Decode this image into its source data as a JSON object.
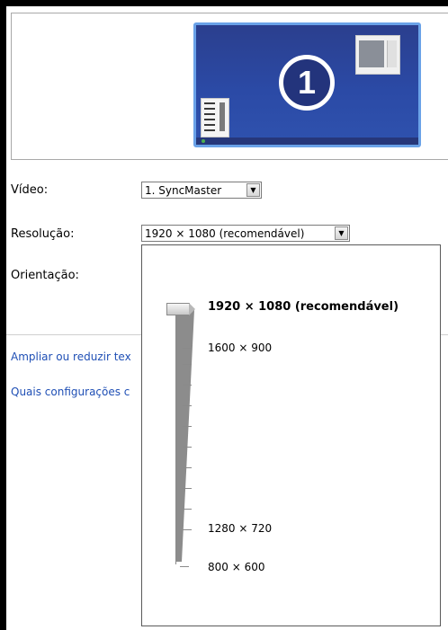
{
  "monitor_preview": {
    "number": "1"
  },
  "form": {
    "video_label": "Vídeo:",
    "video_value": "1. SyncMaster",
    "resolution_label": "Resolução:",
    "resolution_value": "1920 × 1080 (recomendável)",
    "orientation_label": "Orientação:"
  },
  "links": {
    "enlarge_text": "Ampliar ou reduzir tex",
    "which_settings": "Quais configurações c"
  },
  "resolution_slider": {
    "options": [
      {
        "label": "1920 × 1080 (recomendável)",
        "selected": true
      },
      {
        "label": "1600 × 900"
      },
      {
        "label": "1280 × 720"
      },
      {
        "label": "800 × 600"
      }
    ]
  },
  "colors": {
    "accent_link": "#1f4fb5",
    "monitor_blue": "#2b4aa6",
    "monitor_border": "#6aa2e8"
  }
}
